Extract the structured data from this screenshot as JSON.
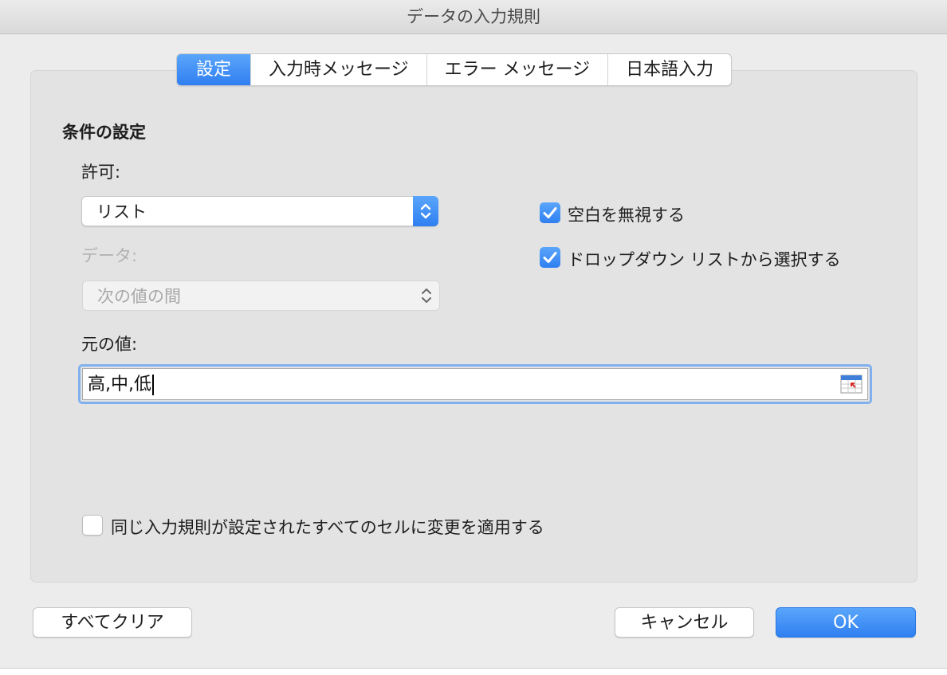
{
  "window": {
    "title": "データの入力規則"
  },
  "tabs": [
    {
      "label": "設定",
      "active": true
    },
    {
      "label": "入力時メッセージ",
      "active": false
    },
    {
      "label": "エラー メッセージ",
      "active": false
    },
    {
      "label": "日本語入力",
      "active": false
    }
  ],
  "criteria": {
    "section_title": "条件の設定",
    "allow_label": "許可:",
    "allow_value": "リスト",
    "data_label": "データ:",
    "data_value": "次の値の間",
    "source_label": "元の値:",
    "source_value": "高,中,低",
    "ignore_blank_label": "空白を無視する",
    "ignore_blank_checked": true,
    "dropdown_label": "ドロップダウン リストから選択する",
    "dropdown_checked": true
  },
  "apply_all": {
    "label": "同じ入力規則が設定されたすべてのセルに変更を適用する",
    "checked": false
  },
  "buttons": {
    "clear_all": "すべてクリア",
    "cancel": "キャンセル",
    "ok": "OK"
  },
  "colors": {
    "accent": "#3b8af5",
    "focus_ring": "#80b1ee",
    "panel": "#e3e3e3"
  }
}
